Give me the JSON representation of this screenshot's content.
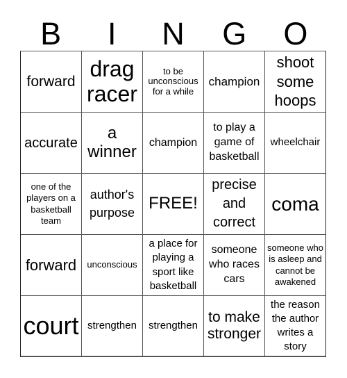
{
  "header": {
    "letters": [
      "B",
      "I",
      "N",
      "G",
      "O"
    ]
  },
  "cells": [
    [
      "forward",
      "drag racer",
      "to be unconscious for a while",
      "champion",
      "shoot some hoops"
    ],
    [
      "accurate",
      "a winner",
      "champion",
      "to play a game of basketball",
      "wheelchair"
    ],
    [
      "one of the players on a basketball team",
      "author's purpose",
      "FREE!",
      "precise and correct",
      "coma"
    ],
    [
      "forward",
      "unconscious",
      "a place for playing a sport like basketball",
      "someone who races cars",
      "someone who is asleep and cannot be awakened"
    ],
    [
      "court",
      "strengthen",
      "strengthen",
      "to make stronger",
      "the reason the author writes a story"
    ]
  ]
}
